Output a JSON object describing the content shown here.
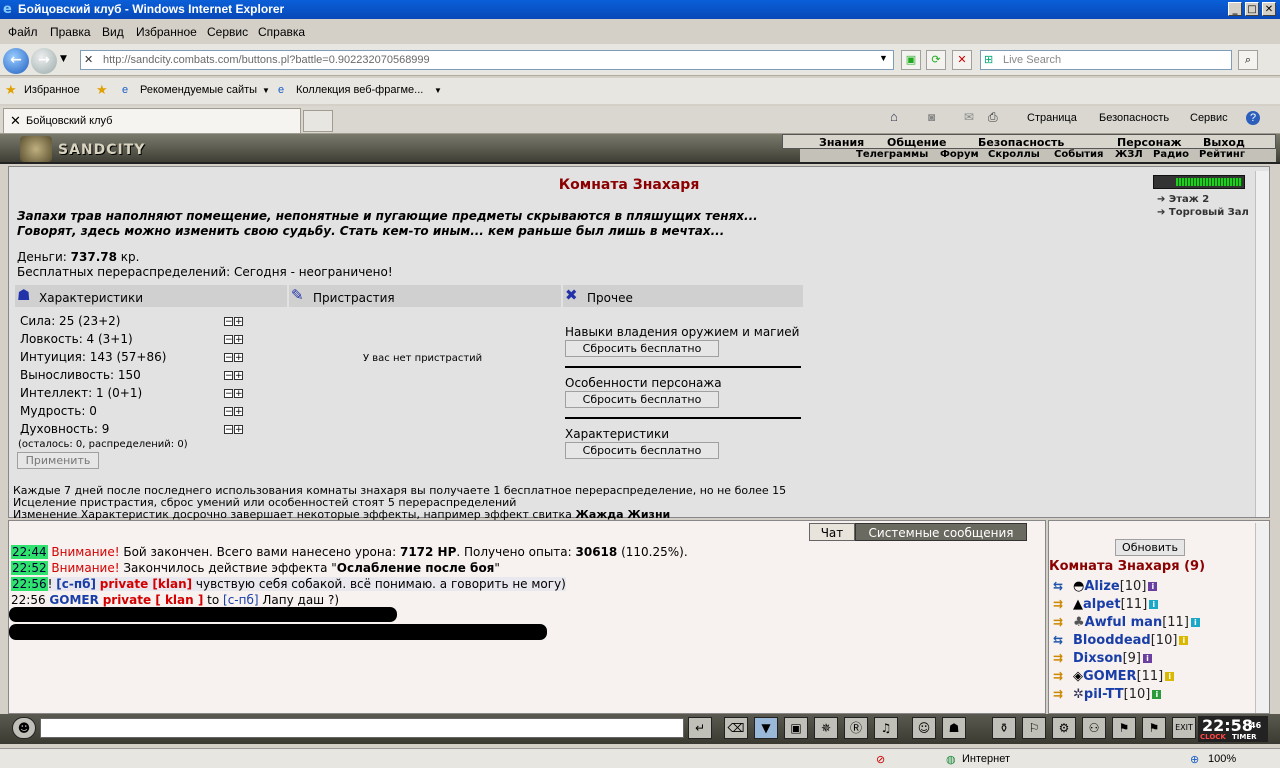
{
  "window": {
    "title": "Бойцовский клуб - Windows Internet Explorer"
  },
  "menu": [
    "Файл",
    "Правка",
    "Вид",
    "Избранное",
    "Сервис",
    "Справка"
  ],
  "address": {
    "url": "http://sandcity.combats.com/buttons.pl?battle=0.902232070568999",
    "search_placeholder": "Live Search"
  },
  "favorites": {
    "label": "Избранное",
    "items": [
      "Рекомендуемые сайты",
      "Коллекция веб-фрагме..."
    ]
  },
  "tabs": {
    "active": "Бойцовский клуб"
  },
  "commandbar": [
    "Страница",
    "Безопасность",
    "Сервис"
  ],
  "game": {
    "logo": "SANDCITY",
    "topnav": [
      "Знания",
      "Общение",
      "Безопасность",
      "Персонаж",
      "Выход"
    ],
    "subnav": [
      "Телеграммы",
      "Форум",
      "Скроллы",
      "События",
      "ЖЗЛ",
      "Радио",
      "Рейтинг"
    ]
  },
  "room": {
    "title": "Комната Знахаря",
    "desc1": "Запахи трав наполняют помещение, непонятные и пугающие предметы скрываются в пляшущих тенях...",
    "desc2": "Говорят, здесь можно изменить свою судьбу. Стать кем-то иным... кем раньше был лишь в мечтах...",
    "money_label": "Деньги: ",
    "money_value": "737.78",
    "money_unit": " кр.",
    "free_redist": "Бесплатных перераспределений: Сегодня - неограничено!",
    "col_stats": "Характеристики",
    "col_addict": "Пристрастия",
    "col_other": "Прочее",
    "stats": [
      "Сила: 25 (23+2)",
      "Ловкость: 4 (3+1)",
      "Интуиция: 143 (57+86)",
      "Выносливость: 150",
      "Интеллект: 1 (0+1)",
      "Мудрость: 0",
      "Духовность: 9"
    ],
    "remaining": "(осталось: 0, распределений: 0)",
    "apply": "Применить",
    "no_addict": "У вас нет пристрастий",
    "other": [
      {
        "label": "Навыки владения оружием и магией",
        "button": "Сбросить бесплатно"
      },
      {
        "label": "Особенности персонажа",
        "button": "Сбросить бесплатно"
      },
      {
        "label": "Характеристики",
        "button": "Сбросить бесплатно"
      }
    ],
    "note1": "Каждые 7 дней после последнего использования комнаты знахаря вы получаете 1 бесплатное перераспределение, но не более 15",
    "note2": "Исцеление пристрастия, сброс умений или особенностей стоят 5 перераспределений",
    "note3": "Изменение Характеристик досрочно завершает некоторые эффекты, например эффект свитка ",
    "note3_bold": "Жажда Жизни",
    "minimap": [
      "Этаж 2",
      "Торговый Зал"
    ]
  },
  "chat": {
    "tab_chat": "Чат",
    "tab_system": "Системные сообщения",
    "m1": {
      "time": "22:44",
      "warn": "Внимание!",
      "text": " Бой закончен. Всего вами нанесено урона: ",
      "dmg": "7172 HP",
      "text2": ". Получено опыта: ",
      "exp": "30618",
      "text3": " (110.25%)."
    },
    "m2": {
      "time": "22:52",
      "warn": "Внимание!",
      "text": " Закончилось действие эффекта \"",
      "effect": "Ослабление после боя",
      "text2": "\""
    },
    "m3": {
      "time": "22:56",
      "bang": "!",
      "channel": "[с-пб]",
      "priv": "private [klan]",
      "text": " чувствую себя собакой. всё понимаю. а говорить не могу)"
    },
    "m4": {
      "time": "22:56",
      "nick": "GOMER",
      "priv": "private [ klan ]",
      "to": " to ",
      "target": "[с-пб]",
      "text": " Лапу даш ?)"
    }
  },
  "users": {
    "refresh": "Обновить",
    "room": "Комната Знахаря (9)",
    "list": [
      {
        "name": "Alize",
        "level": "[10]"
      },
      {
        "name": "alpet",
        "level": "[11]"
      },
      {
        "name": "Awful man",
        "level": "[11]"
      },
      {
        "name": "Blooddead",
        "level": "[10]"
      },
      {
        "name": "Dixson",
        "level": "[9]"
      },
      {
        "name": "GOMER",
        "level": "[11]"
      },
      {
        "name": "pil-TT",
        "level": "[10]"
      }
    ]
  },
  "clock": {
    "time": "22:58",
    "seconds": "46",
    "label1": "CLOCK",
    "label2": "TIMER"
  },
  "status": {
    "zone": "Интернет",
    "zoom": "100%"
  }
}
